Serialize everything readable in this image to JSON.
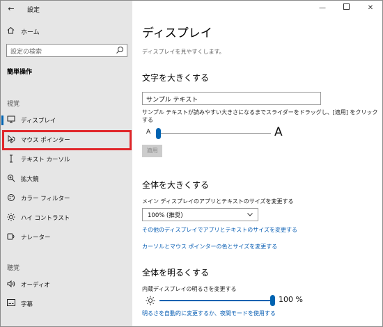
{
  "app": {
    "title": "設定"
  },
  "sidebar": {
    "home_label": "ホーム",
    "search_placeholder": "設定の検索",
    "section_title": "簡単操作",
    "group_vision": "視覚",
    "group_hearing": "聴覚",
    "items": [
      {
        "label": "ディスプレイ",
        "icon": "monitor-icon"
      },
      {
        "label": "マウス ポインター",
        "icon": "mouse-pointer-icon"
      },
      {
        "label": "テキスト カーソル",
        "icon": "text-cursor-icon"
      },
      {
        "label": "拡大鏡",
        "icon": "magnifier-icon"
      },
      {
        "label": "カラー フィルター",
        "icon": "color-filter-icon"
      },
      {
        "label": "ハイ コントラスト",
        "icon": "high-contrast-icon"
      },
      {
        "label": "ナレーター",
        "icon": "narrator-icon"
      },
      {
        "label": "オーディオ",
        "icon": "speaker-icon"
      },
      {
        "label": "字幕",
        "icon": "captions-icon"
      }
    ],
    "selected_item": "ディスプレイ",
    "highlighted_item": "マウス ポインター",
    "highlight_color": "#e0262a"
  },
  "main": {
    "title": "ディスプレイ",
    "description": "ディスプレイを見やすくします。",
    "text_size": {
      "heading": "文字を大きくする",
      "sample_text": "サンプル テキスト",
      "instruction": "サンプル テキストが読みやすい大きさになるまでスライダーをドラッグし、[適用] をクリックする",
      "small_label": "A",
      "large_label": "A",
      "slider_level": 0.0,
      "apply_label": "適用"
    },
    "scale": {
      "heading": "全体を大きくする",
      "dropdown_label": "メイン ディスプレイのアプリとテキストのサイズを変更する",
      "dropdown_value": "100% (推奨)",
      "link_other": "その他のディスプレイでアプリとテキストのサイズを変更する",
      "link_cursor": "カーソルとマウス ポインターの色とサイズを変更する"
    },
    "brightness": {
      "heading": "全体を明るくする",
      "slider_label": "内蔵ディスプレイの明るさを変更する",
      "value_text": "100 %",
      "level": 1.0,
      "link_auto": "明るさを自動的に変更するか、夜間モードを使用する"
    }
  },
  "colors": {
    "accent": "#0063b1",
    "link": "#0a5fb4",
    "sidebar_bg": "#e6e6e6"
  }
}
